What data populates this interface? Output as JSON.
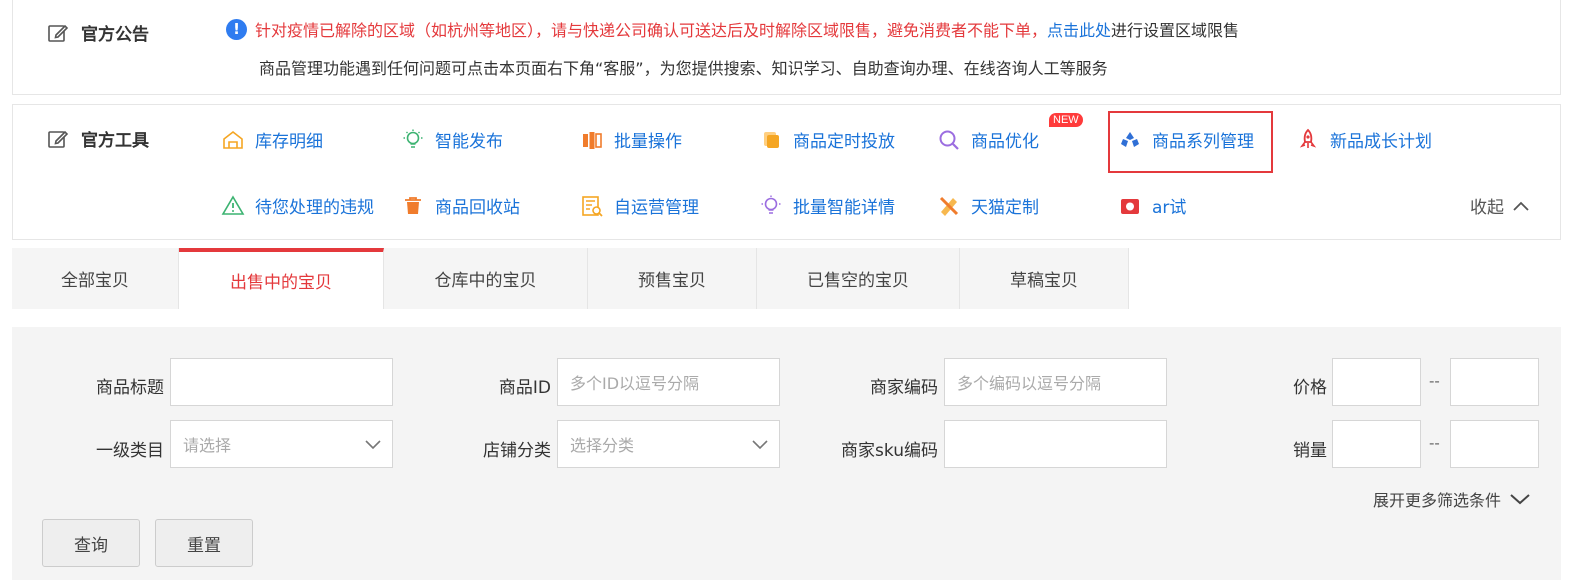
{
  "notice": {
    "title": "官方公告",
    "line1_red": "针对疫情已解除的区域（如杭州等地区），请与快递公司确认可送达后及时解除区域限售，避免消费者不能下单，",
    "line1_link": "点击此处",
    "line1_tail": "进行设置区域限售",
    "line2": "商品管理功能遇到任何问题可点击本页面右下角“客服”，为您提供搜索、知识学习、自助查询办理、在线咨询人工等服务"
  },
  "tools": {
    "title": "官方工具",
    "row1": [
      {
        "label": "库存明细",
        "icon": "warehouse-icon"
      },
      {
        "label": "智能发布",
        "icon": "lightbulb-icon"
      },
      {
        "label": "批量操作",
        "icon": "batch-icon"
      },
      {
        "label": "商品定时投放",
        "icon": "timer-icon"
      },
      {
        "label": "商品优化",
        "icon": "search-icon",
        "badge": "NEW"
      },
      {
        "label": "商品系列管理",
        "icon": "series-icon"
      },
      {
        "label": "新品成长计划",
        "icon": "rocket-icon"
      }
    ],
    "row2": [
      {
        "label": "待您处理的违规",
        "icon": "warning-icon"
      },
      {
        "label": "商品回收站",
        "icon": "trash-icon"
      },
      {
        "label": "自运营管理",
        "icon": "self-ops-icon"
      },
      {
        "label": "批量智能详情",
        "icon": "smart-bulb-icon"
      },
      {
        "label": "天猫定制",
        "icon": "pencil-ruler-icon"
      },
      {
        "label": "ar试",
        "icon": "camera-icon"
      }
    ],
    "collapse_label": "收起"
  },
  "tabs": [
    "全部宝贝",
    "出售中的宝贝",
    "仓库中的宝贝",
    "预售宝贝",
    "已售空的宝贝",
    "草稿宝贝"
  ],
  "active_tab": 1,
  "filter": {
    "title_label": "商品标题",
    "id_label": "商品ID",
    "id_placeholder": "多个ID以逗号分隔",
    "code_label": "商家编码",
    "code_placeholder": "多个编码以逗号分隔",
    "price_label": "价格",
    "category_label": "一级类目",
    "category_placeholder": "请选择",
    "shop_cat_label": "店铺分类",
    "shop_cat_placeholder": "选择分类",
    "sku_label": "商家sku编码",
    "sales_label": "销量",
    "range_sep": "--",
    "more_label": "展开更多筛选条件",
    "query_button": "查询",
    "reset_button": "重置"
  },
  "colors": {
    "accent_red": "#e4393c",
    "link_blue": "#1a73d9",
    "info_blue": "#2f7cf0"
  }
}
